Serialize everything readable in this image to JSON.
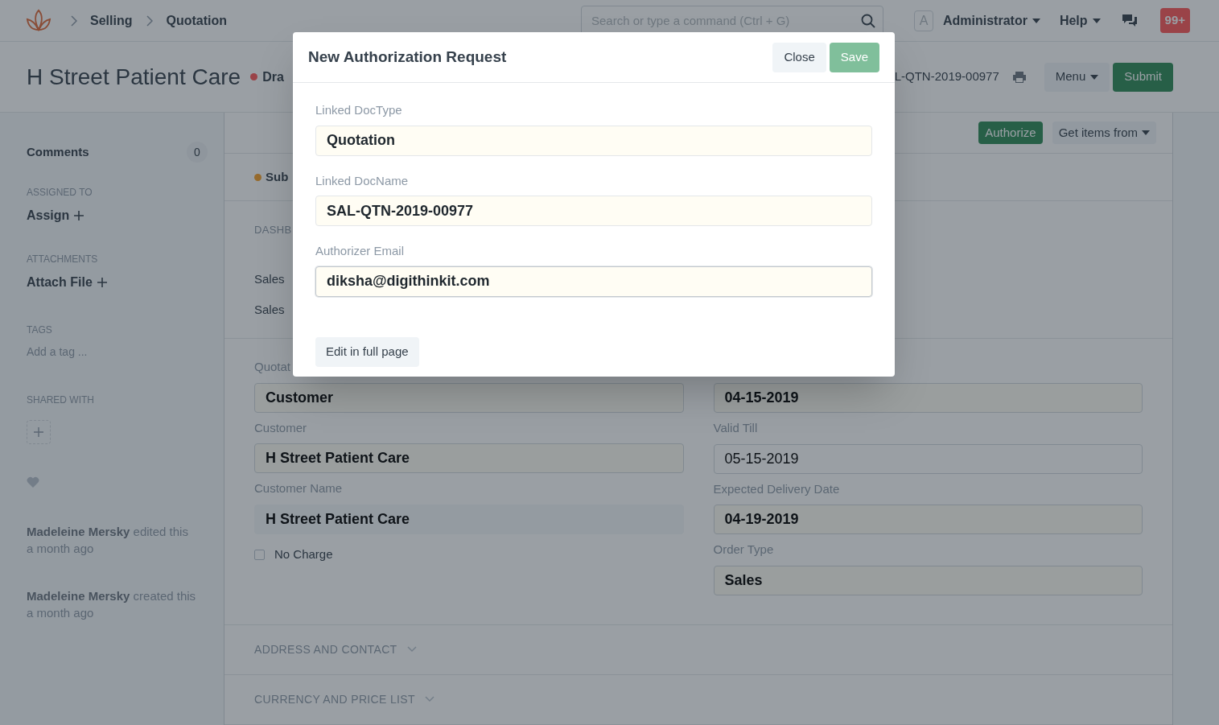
{
  "navbar": {
    "breadcrumbs": [
      "Selling",
      "Quotation"
    ],
    "search": {
      "placeholder": "Search or type a command (Ctrl + G)"
    },
    "avatar_letter": "A",
    "user": "Administrator",
    "help": "Help",
    "notifications": "99+"
  },
  "title_bar": {
    "title": "H Street Patient Care",
    "status": "Dra",
    "doc_name": "L-QTN-2019-00977",
    "menu": "Menu",
    "submit": "Submit"
  },
  "sidebar": {
    "comments": {
      "label": "Comments",
      "count": "0"
    },
    "sections": [
      {
        "heading": "ASSIGNED TO",
        "action": "Assign"
      },
      {
        "heading": "ATTACHMENTS",
        "action": "Attach File"
      }
    ],
    "tags": {
      "heading": "TAGS",
      "placeholder": "Add a tag ..."
    },
    "shared_with": "SHARED WITH",
    "activity": [
      {
        "user": "Madeleine Mersky",
        "action": "edited this",
        "time": "a month ago"
      },
      {
        "user": "Madeleine Mersky",
        "action": "created this",
        "time": "a month ago"
      }
    ]
  },
  "toolbar": {
    "buttons": [
      {
        "label": "Authorize",
        "kind": "primary"
      },
      {
        "label": "Get items from",
        "kind": "dropdown"
      }
    ]
  },
  "indicator": "Sub",
  "dashboard": {
    "heading": "DASHB",
    "links": [
      "Sales",
      "Sales"
    ]
  },
  "form": {
    "left": [
      {
        "label": "Quotat",
        "value": "Customer",
        "kind": "mandatory"
      },
      {
        "label": "Customer",
        "value": "H Street Patient Care",
        "kind": "mandatory"
      },
      {
        "label": "Customer Name",
        "value": "H Street Patient Care",
        "kind": "readonly"
      }
    ],
    "no_charge": {
      "label": "No Charge",
      "checked": false
    },
    "right": [
      {
        "value": "04-15-2019",
        "kind": "mandatory"
      },
      {
        "label": "Valid Till",
        "value": "05-15-2019",
        "kind": "normal"
      },
      {
        "label": "Expected Delivery Date",
        "value": "04-19-2019",
        "kind": "mandatory"
      },
      {
        "label": "Order Type",
        "value": "Sales",
        "kind": "mandatory"
      }
    ]
  },
  "sections": [
    {
      "title": "ADDRESS AND CONTACT",
      "expanded": false
    },
    {
      "title": "CURRENCY AND PRICE LIST",
      "expanded": false
    }
  ],
  "dialog": {
    "title": "New Authorization Request",
    "close": "Close",
    "save": "Save",
    "fields": [
      {
        "label": "Linked DocType",
        "value": "Quotation",
        "focused": false
      },
      {
        "label": "Linked DocName",
        "value": "SAL-QTN-2019-00977",
        "focused": false
      },
      {
        "label": "Authorizer Email",
        "value": "diksha@digithinkit.com",
        "focused": true
      }
    ],
    "edit_full": "Edit in full page"
  }
}
